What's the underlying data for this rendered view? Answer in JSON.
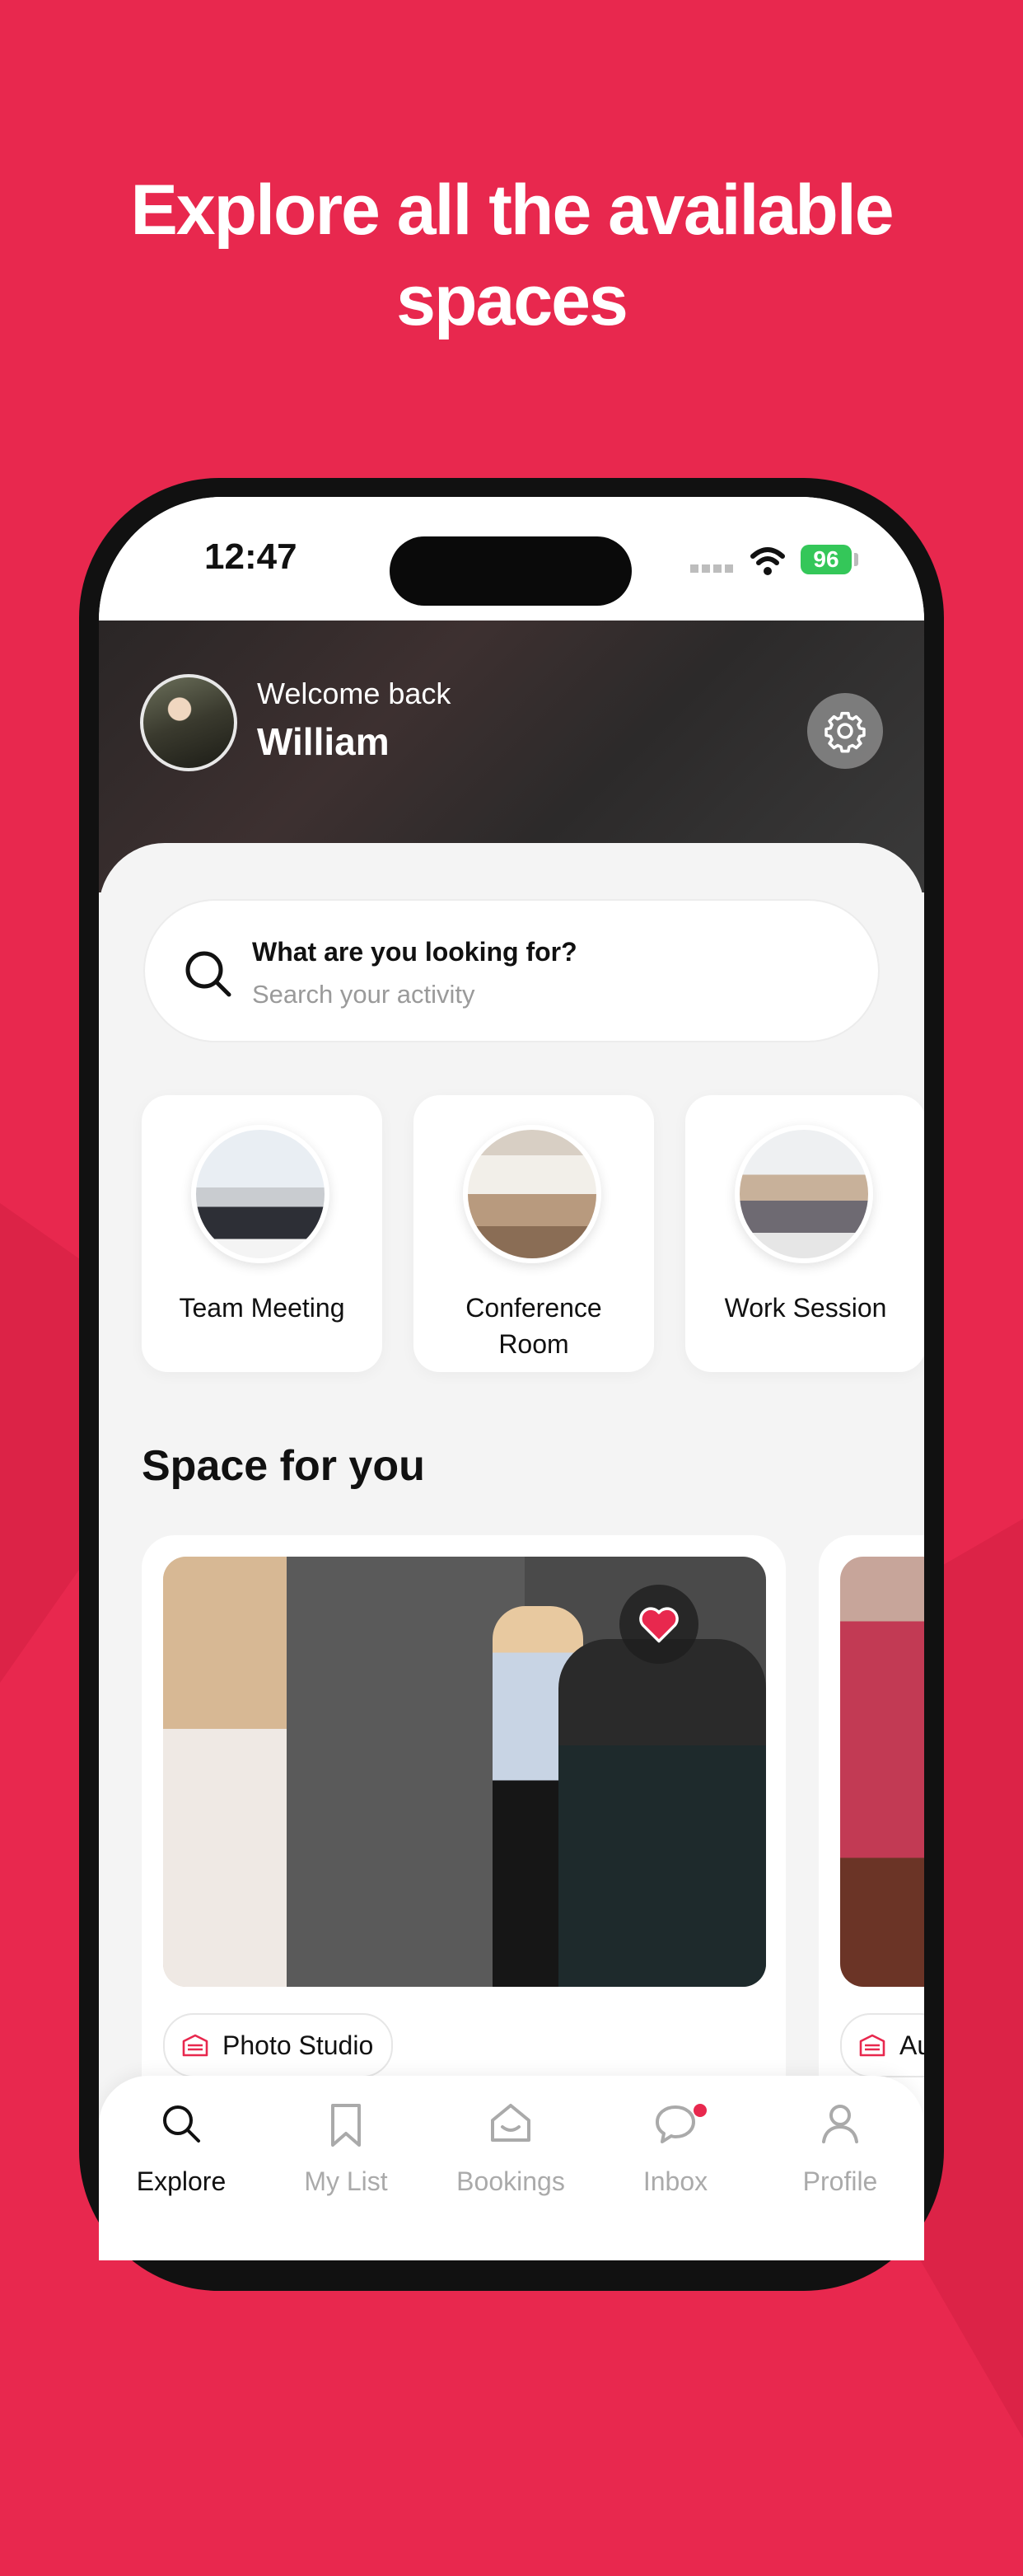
{
  "headline": {
    "line1": "Explore all the available",
    "line2": "spaces"
  },
  "status_bar": {
    "time": "12:47",
    "battery": "96"
  },
  "header": {
    "welcome": "Welcome back",
    "username": "William"
  },
  "search": {
    "title": "What are you looking for?",
    "placeholder": "Search your activity"
  },
  "categories": [
    {
      "label": "Team Meeting"
    },
    {
      "label": "Conference Room"
    },
    {
      "label": "Work Session"
    }
  ],
  "section": {
    "title": "Space for you"
  },
  "spaces": [
    {
      "tag": "Photo Studio",
      "favorited": true
    },
    {
      "tag": "Au",
      "favorited": false
    }
  ],
  "tabs": [
    {
      "label": "Explore",
      "icon": "search-icon",
      "active": true
    },
    {
      "label": "My List",
      "icon": "bookmark-icon",
      "active": false
    },
    {
      "label": "Bookings",
      "icon": "bookings-icon",
      "active": false
    },
    {
      "label": "Inbox",
      "icon": "chat-icon",
      "active": false
    },
    {
      "label": "Profile",
      "icon": "person-icon",
      "active": false
    }
  ],
  "colors": {
    "brand": "#E8284E",
    "battery": "#34C759"
  }
}
